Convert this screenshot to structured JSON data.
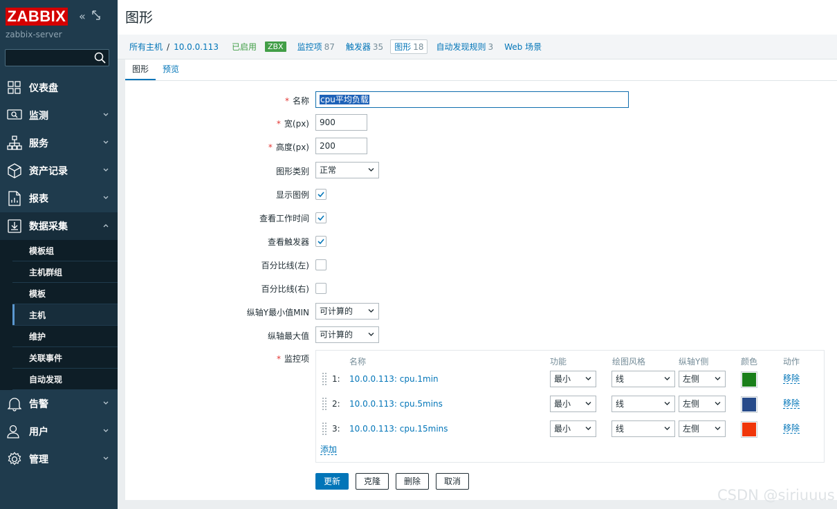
{
  "sidebar": {
    "logo": "ZABBIX",
    "server": "zabbix-server",
    "menu": [
      {
        "label": "仪表盘",
        "icon": "dashboard-icon"
      },
      {
        "label": "监测",
        "icon": "monitoring-icon"
      },
      {
        "label": "服务",
        "icon": "services-icon"
      },
      {
        "label": "资产记录",
        "icon": "inventory-icon"
      },
      {
        "label": "报表",
        "icon": "reports-icon"
      },
      {
        "label": "数据采集",
        "icon": "data-collection-icon"
      },
      {
        "label": "告警",
        "icon": "alerts-icon"
      },
      {
        "label": "用户",
        "icon": "users-icon"
      },
      {
        "label": "管理",
        "icon": "administration-icon"
      }
    ],
    "submenu": [
      "模板组",
      "主机群组",
      "模板",
      "主机",
      "维护",
      "关联事件",
      "自动发现"
    ]
  },
  "header": {
    "title": "图形"
  },
  "hostnav": {
    "all_hosts": "所有主机",
    "separator": "/",
    "host": "10.0.0.113",
    "status": "已启用",
    "zbx": "ZBX",
    "tabs": [
      {
        "label": "监控项",
        "count": "87"
      },
      {
        "label": "触发器",
        "count": "35"
      },
      {
        "label": "图形",
        "count": "18"
      },
      {
        "label": "自动发现规则",
        "count": "3"
      },
      {
        "label": "Web 场景",
        "count": ""
      }
    ]
  },
  "form_tabs": [
    "图形",
    "预览"
  ],
  "form": {
    "name_label": "名称",
    "name_value": "cpu平均负载",
    "width_label": "宽(px)",
    "width_value": "900",
    "height_label": "高度(px)",
    "height_value": "200",
    "graph_type_label": "图形类别",
    "graph_type_value": "正常",
    "show_legend_label": "显示图例",
    "show_legend": true,
    "work_period_label": "查看工作时间",
    "work_period": true,
    "triggers_label": "查看触发器",
    "triggers": true,
    "percent_left_label": "百分比线(左)",
    "percent_left": false,
    "percent_right_label": "百分比线(右)",
    "percent_right": false,
    "ymin_label": "纵轴Y最小值MIN",
    "ymin_value": "可计算的",
    "ymax_label": "纵轴最大值",
    "ymax_value": "可计算的",
    "items_label": "监控项"
  },
  "items": {
    "headers": {
      "name": "名称",
      "function": "功能",
      "style": "绘图风格",
      "axis": "纵轴Y侧",
      "color": "颜色",
      "action": "动作"
    },
    "rows": [
      {
        "num": "1:",
        "name": "10.0.0.113: cpu.1min",
        "function": "最小",
        "style": "线",
        "axis": "左侧",
        "color": "#1a7f1a",
        "action": "移除"
      },
      {
        "num": "2:",
        "name": "10.0.0.113: cpu.5mins",
        "function": "最小",
        "style": "线",
        "axis": "左侧",
        "color": "#274b8a",
        "action": "移除"
      },
      {
        "num": "3:",
        "name": "10.0.0.113: cpu.15mins",
        "function": "最小",
        "style": "线",
        "axis": "左侧",
        "color": "#f0360a",
        "action": "移除"
      }
    ],
    "add": "添加"
  },
  "buttons": {
    "update": "更新",
    "clone": "克隆",
    "delete": "删除",
    "cancel": "取消"
  },
  "watermark": "CSDN @siriuuus"
}
